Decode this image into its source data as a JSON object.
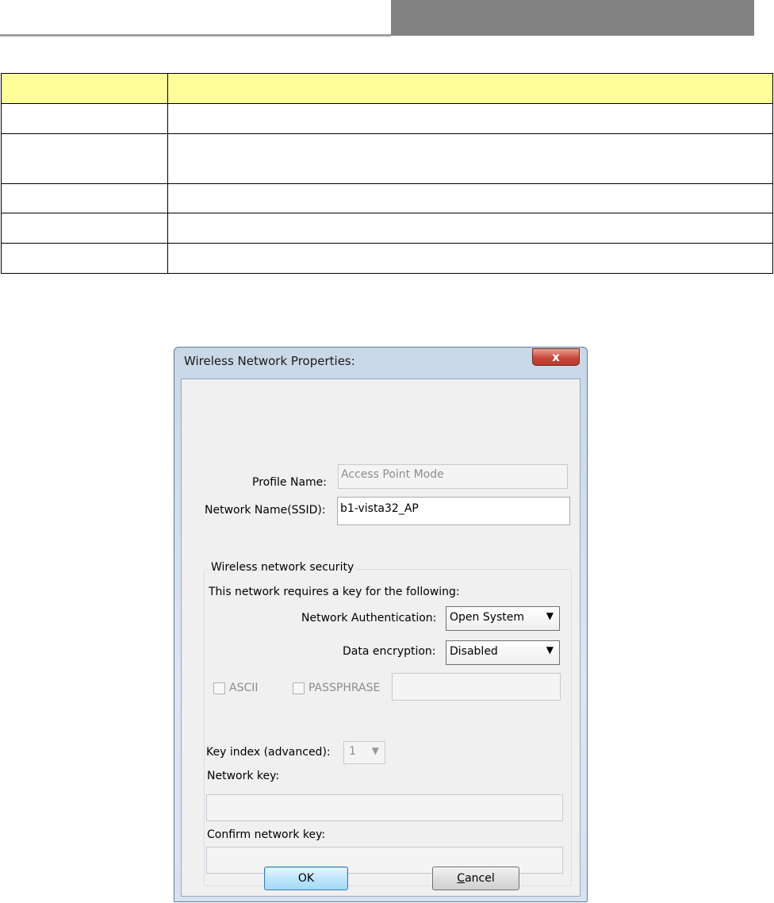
{
  "dialog": {
    "title": "Wireless Network Properties:",
    "close_label": "x",
    "profile_name_label": "Profile Name:",
    "profile_name_value": "Access Point Mode",
    "ssid_label": "Network Name(SSID):",
    "ssid_value": "b1-vista32_AP",
    "security_group_label": "Wireless network security",
    "requires_key_text": "This network requires a key for the following:",
    "auth_label": "Network Authentication:",
    "auth_value": "Open System",
    "encryption_label": "Data encryption:",
    "encryption_value": "Disabled",
    "ascii_label": "ASCII",
    "passphrase_label": "PASSPHRASE",
    "passphrase_value": "",
    "key_index_label": "Key index (advanced):",
    "key_index_value": "1",
    "network_key_label": "Network key:",
    "network_key_value": "",
    "confirm_key_label": "Confirm network key:",
    "confirm_key_value": "",
    "ok_label": "OK",
    "cancel_label_first": "C",
    "cancel_label_rest": "ancel"
  }
}
